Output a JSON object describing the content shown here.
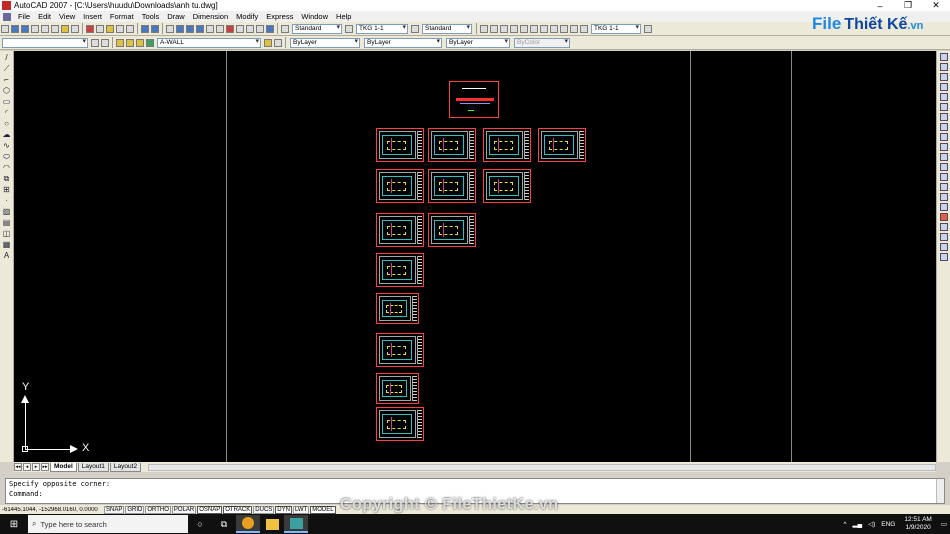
{
  "window": {
    "title": "AutoCAD 2007 - [C:\\Users\\huudu\\Downloads\\anh tu.dwg]",
    "min_glyph": "–",
    "max_glyph": "❐",
    "close_glyph": "✕"
  },
  "menu": [
    "File",
    "Edit",
    "View",
    "Insert",
    "Format",
    "Tools",
    "Draw",
    "Dimension",
    "Modify",
    "Express",
    "Window",
    "Help"
  ],
  "toolbar": {
    "text_style": "Standard",
    "dim_style": "TKG 1-1",
    "table_style": "Standard",
    "mleader_style": "TKG 1-1",
    "workspace": "",
    "layer": "A-WALL",
    "color": "ByLayer",
    "linetype": "ByLayer",
    "lineweight": "ByLayer",
    "plotstyle": "ByColor"
  },
  "logo": {
    "part1": "File",
    "part2": "Thiết Kế",
    "part3": ".vn"
  },
  "ucs": {
    "x_label": "X",
    "y_label": "Y"
  },
  "tabs": {
    "nav": [
      "◂◂",
      "◂",
      "▸",
      "▸▸"
    ],
    "items": [
      "Model",
      "Layout1",
      "Layout2"
    ],
    "active": "Model"
  },
  "command": {
    "line1": "Specify opposite corner:",
    "line2": "Command:"
  },
  "status": {
    "coords": "-61445.1044, -152968.0160, 0.0000",
    "buttons": [
      {
        "label": "SNAP",
        "on": false
      },
      {
        "label": "GRID",
        "on": false
      },
      {
        "label": "ORTHO",
        "on": false
      },
      {
        "label": "POLAR",
        "on": false
      },
      {
        "label": "OSNAP",
        "on": true
      },
      {
        "label": "OTRACK",
        "on": true
      },
      {
        "label": "DUCS",
        "on": false
      },
      {
        "label": "DYN",
        "on": true
      },
      {
        "label": "LWT",
        "on": false
      },
      {
        "label": "MODEL",
        "on": true
      }
    ]
  },
  "taskbar": {
    "search_placeholder": "Type here to search",
    "tray_caret": "^",
    "lang": "ENG",
    "time": "12:51 AM",
    "date": "1/9/2020"
  },
  "watermark": "Copyright © FileThietKe.vn",
  "colors": {
    "canvas": "#000000",
    "sheet_border": "#ff4040",
    "logo_blue": "#1e88e5"
  }
}
